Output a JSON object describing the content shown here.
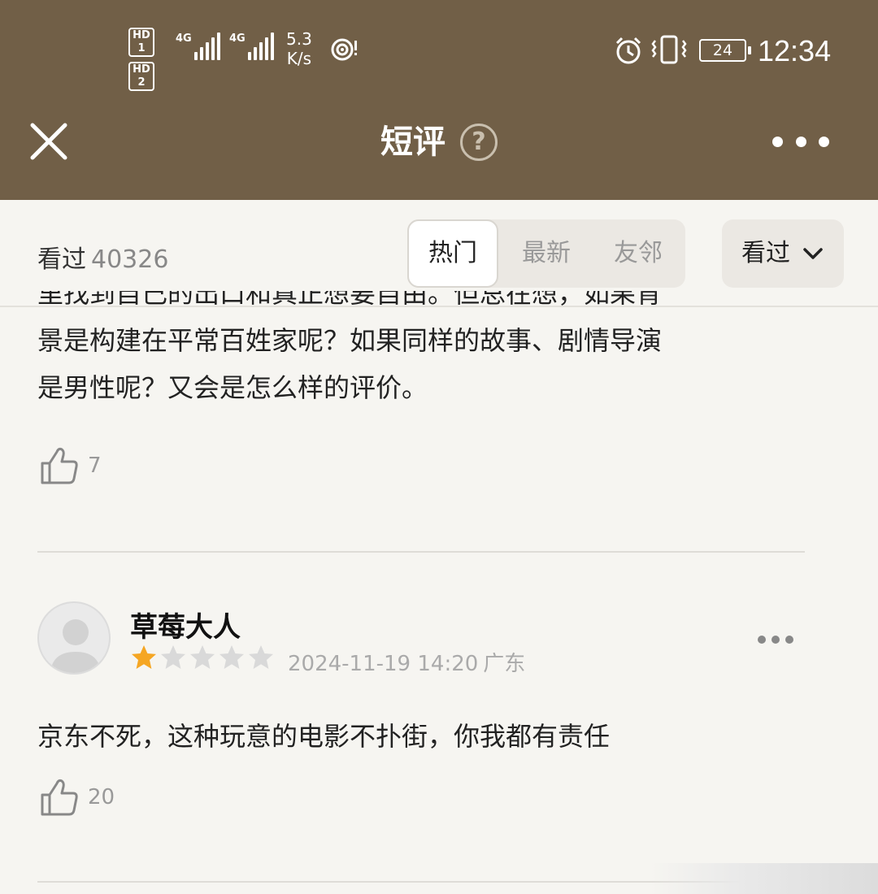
{
  "status_bar": {
    "sim1": "HD 1",
    "sim2": "HD 2",
    "net1": "4G",
    "net2": "4G",
    "speed_value": "5.3",
    "speed_unit": "K/s",
    "battery": "24",
    "time": "12:34"
  },
  "header": {
    "title": "短评",
    "help": "?",
    "close_icon": "close-icon",
    "more_icon": "more-icon"
  },
  "filter": {
    "seen_label": "看过",
    "seen_count": "40326",
    "tabs": [
      {
        "label": "热门",
        "active": true
      },
      {
        "label": "最新",
        "active": false
      },
      {
        "label": "友邻",
        "active": false
      }
    ],
    "dropdown_label": "看过"
  },
  "comments": [
    {
      "text_lines": [
        "里找到自己的出口和真正想要自由。但总在想，如果背",
        "景是构建在平常百姓家呢？如果同样的故事、剧情导演",
        "是男性呢？又会是怎么样的评价。"
      ],
      "likes": "7"
    },
    {
      "username": "草莓大人",
      "rating": 1,
      "rating_max": 5,
      "date": "2024-11-19 14:20",
      "location": "广东",
      "text": "京东不死，这种玩意的电影不扑街，你我都有责任",
      "likes": "20"
    }
  ],
  "colors": {
    "header_bg": "#715f47",
    "page_bg": "#f6f5f1",
    "star_on": "#f5a623",
    "star_off": "#d9d9d9"
  }
}
